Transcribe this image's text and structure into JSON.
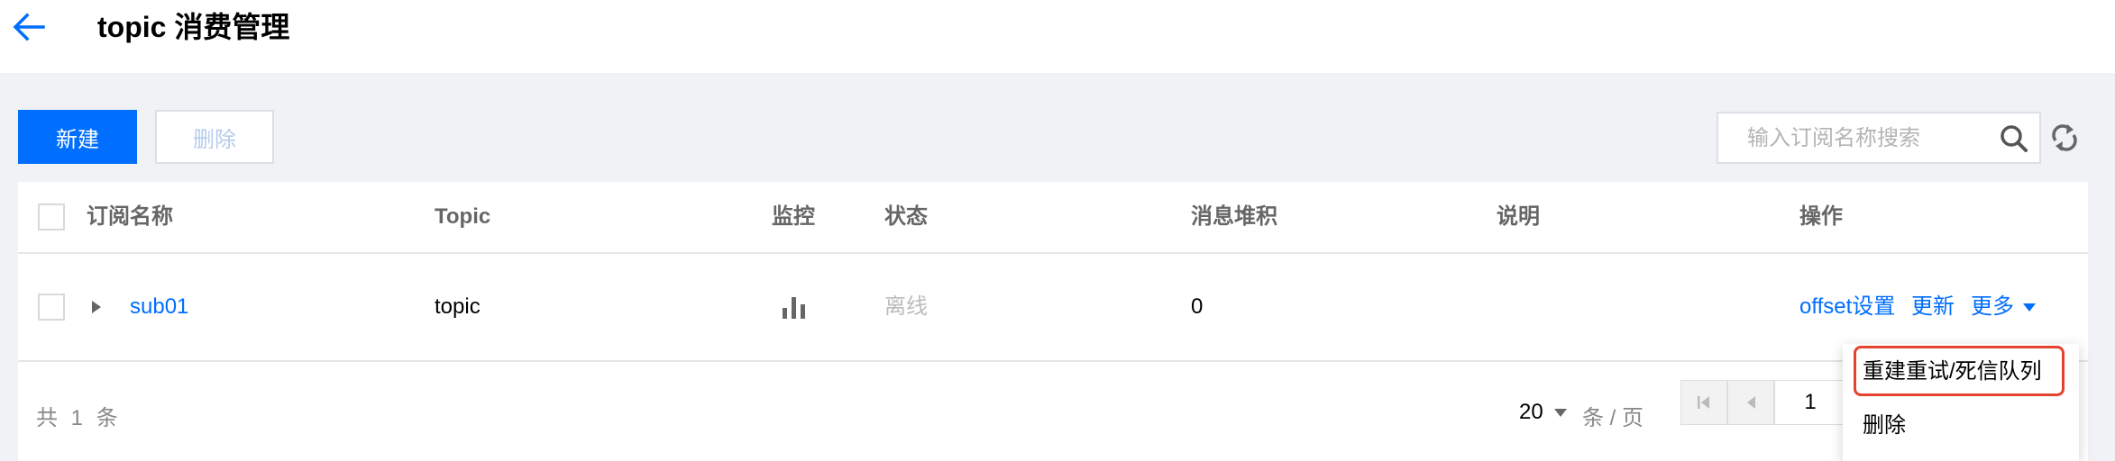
{
  "header": {
    "title": "topic 消费管理"
  },
  "toolbar": {
    "create_label": "新建",
    "delete_label": "删除"
  },
  "search": {
    "placeholder": "输入订阅名称搜索",
    "value": ""
  },
  "table": {
    "columns": [
      "订阅名称",
      "Topic",
      "监控",
      "状态",
      "消息堆积",
      "说明",
      "操作"
    ],
    "rows": [
      {
        "name": "sub01",
        "topic": "topic",
        "status": "离线",
        "backlog": "0",
        "description": "",
        "actions": {
          "offset": "offset设置",
          "update": "更新",
          "more": "更多"
        }
      }
    ]
  },
  "footer": {
    "total": "共 1 条",
    "page_size": "20",
    "page_size_unit": "条 / 页",
    "current_page": "1"
  },
  "more_menu": {
    "items": [
      "重建重试/死信队列",
      "删除"
    ],
    "highlighted_item": "重建重试/死信队列"
  },
  "colors": {
    "primary": "#006eff",
    "highlight_border": "#e5432f",
    "background": "#f0f2f6"
  }
}
